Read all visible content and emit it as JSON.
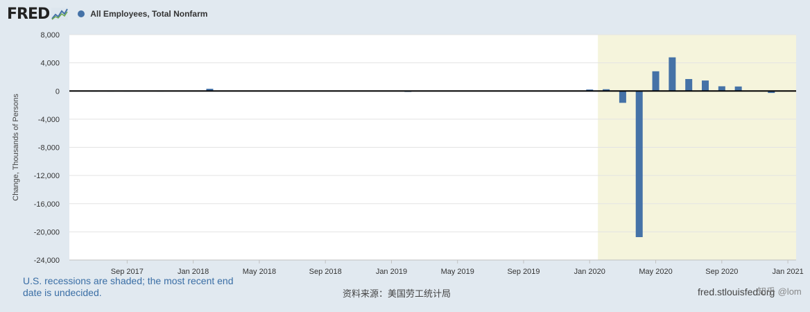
{
  "brand": {
    "logo_text": "FRED"
  },
  "legend": {
    "label": "All Employees, Total Nonfarm",
    "color": "#4572a7"
  },
  "footer": {
    "note": "U.S. recessions are shaded; the most recent end date is undecided.",
    "source": "资料来源：美国劳工统计局",
    "site": "fred.stlouisfed.org",
    "watermark": "知乎 @lom"
  },
  "chart_data": {
    "type": "bar",
    "title": "",
    "ylabel": "Change, Thousands of Persons",
    "xlabel": "",
    "ylim": [
      -24000,
      8000
    ],
    "yticks": [
      8000,
      4000,
      0,
      -4000,
      -8000,
      -12000,
      -16000,
      -20000,
      -24000
    ],
    "ytick_labels": [
      "8,000",
      "4,000",
      "0",
      "-4,000",
      "-8,000",
      "-12,000",
      "-16,000",
      "-20,000",
      "-24,000"
    ],
    "xticks": [
      {
        "label": "Sep 2017",
        "date": "2017-09"
      },
      {
        "label": "Jan 2018",
        "date": "2018-01"
      },
      {
        "label": "May 2018",
        "date": "2018-05"
      },
      {
        "label": "Sep 2018",
        "date": "2018-09"
      },
      {
        "label": "Jan 2019",
        "date": "2019-01"
      },
      {
        "label": "May 2019",
        "date": "2019-05"
      },
      {
        "label": "Sep 2019",
        "date": "2019-09"
      },
      {
        "label": "Jan 2020",
        "date": "2020-01"
      },
      {
        "label": "May 2020",
        "date": "2020-05"
      },
      {
        "label": "Sep 2020",
        "date": "2020-09"
      },
      {
        "label": "Jan 2021",
        "date": "2021-01"
      }
    ],
    "x_range": [
      "2017-06",
      "2021-01"
    ],
    "recession": {
      "start": "2020-02",
      "end": "2021-01",
      "color": "#f5f4dc"
    },
    "bar_color": "#4572a7",
    "grid": true,
    "series": [
      {
        "x": [
          "2017-06",
          "2017-07",
          "2017-08",
          "2017-09",
          "2017-10",
          "2017-11",
          "2017-12",
          "2018-01",
          "2018-02",
          "2018-03",
          "2018-04",
          "2018-05",
          "2018-06",
          "2018-07",
          "2018-08",
          "2018-09",
          "2018-10",
          "2018-11",
          "2018-12",
          "2019-01",
          "2019-02",
          "2019-03",
          "2019-04",
          "2019-05",
          "2019-06",
          "2019-07",
          "2019-08",
          "2019-09",
          "2019-10",
          "2019-11",
          "2019-12",
          "2020-01",
          "2020-02",
          "2020-03",
          "2020-04",
          "2020-05",
          "2020-06",
          "2020-07",
          "2020-08",
          "2020-09",
          "2020-10",
          "2020-11",
          "2020-12"
        ],
        "values": [
          30,
          20,
          20,
          20,
          30,
          20,
          40,
          30,
          320,
          30,
          30,
          30,
          30,
          30,
          30,
          30,
          30,
          30,
          30,
          40,
          -130,
          30,
          30,
          30,
          30,
          30,
          30,
          30,
          30,
          30,
          30,
          210,
          250,
          -1680,
          -20750,
          2800,
          4780,
          1700,
          1490,
          670,
          640,
          30,
          -280
        ]
      }
    ]
  }
}
